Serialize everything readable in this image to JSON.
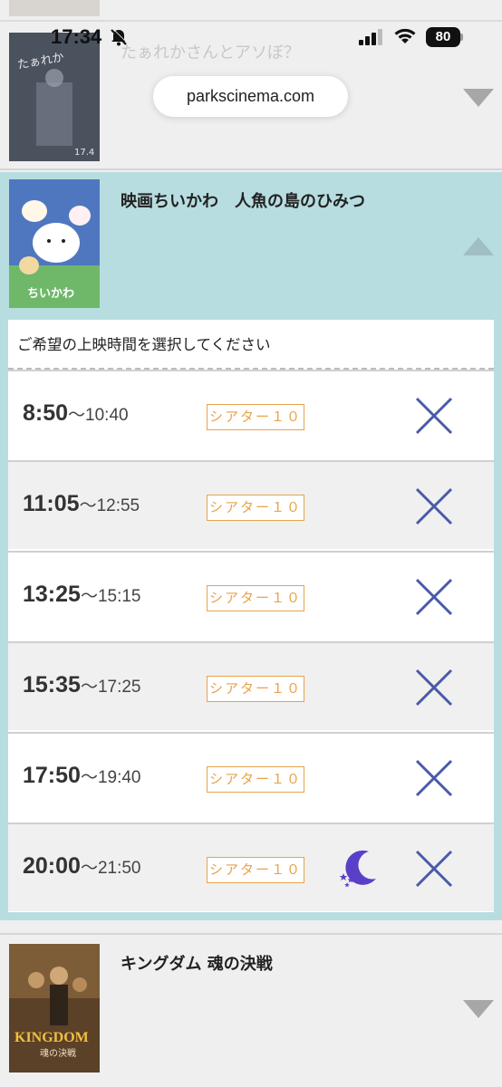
{
  "status_bar": {
    "time": "17:34",
    "battery": "80"
  },
  "browser": {
    "url": "parkscinema.com"
  },
  "movies": [
    {
      "title": "たぁれかさんとアソぼ？",
      "expanded": false,
      "poster_label": "17.4"
    },
    {
      "title": "映画ちいかわ　人魚の島のひみつ",
      "expanded": true,
      "poster_label": "ちいかわ",
      "prompt": "ご希望の上映時間を選択してください",
      "showtimes": [
        {
          "start": "8:50",
          "end": "〜10:40",
          "theater": "シアター１０",
          "status": "sold-out",
          "late_show": false
        },
        {
          "start": "11:05",
          "end": "〜12:55",
          "theater": "シアター１０",
          "status": "sold-out",
          "late_show": false
        },
        {
          "start": "13:25",
          "end": "〜15:15",
          "theater": "シアター１０",
          "status": "sold-out",
          "late_show": false
        },
        {
          "start": "15:35",
          "end": "〜17:25",
          "theater": "シアター１０",
          "status": "sold-out",
          "late_show": false
        },
        {
          "start": "17:50",
          "end": "〜19:40",
          "theater": "シアター１０",
          "status": "sold-out",
          "late_show": false
        },
        {
          "start": "20:00",
          "end": "〜21:50",
          "theater": "シアター１０",
          "status": "sold-out",
          "late_show": true
        }
      ]
    },
    {
      "title": "キングダム 魂の決戦",
      "expanded": false,
      "poster_label": "KINGDOM"
    }
  ],
  "colors": {
    "expanded_bg": "#b7dde0",
    "theater_badge": "#e8a349",
    "sold_out_mark": "#4a5aa8",
    "moon": "#5a3fc8"
  },
  "icons": {
    "sold_out": "x-mark-icon",
    "late_show": "moon-stars-icon",
    "collapse": "chevron-up-icon",
    "expand": "chevron-down-icon"
  }
}
